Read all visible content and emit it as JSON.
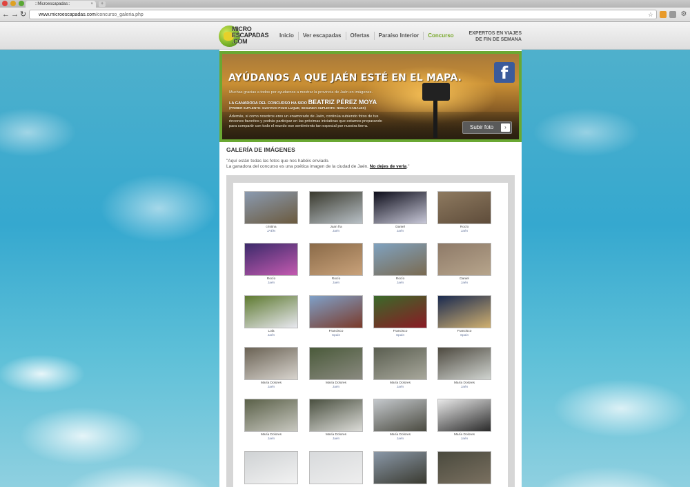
{
  "browser": {
    "tab_title": "::Microescapadas::",
    "tab_close": "×",
    "new_tab": "+",
    "url_host": "www.microescapadas.com",
    "url_path": "/concurso_galeria.php",
    "back": "←",
    "forward": "→",
    "reload": "↻"
  },
  "site": {
    "logo_line1": "MICRO",
    "logo_line2": "ESCAPADAS",
    "logo_line3": ".COM",
    "nav": [
      "Inicio",
      "Ver escapadas",
      "Ofertas",
      "Paraíso Interior",
      "Concurso"
    ],
    "tagline_line1": "EXPERTOS EN VIAJES",
    "tagline_line2": "DE FIN DE SEMANA"
  },
  "banner": {
    "title": "AYÚDANOS A QUE JAÉN ESTÉ EN EL MAPA.",
    "thanks": "Muchas gracias a todos por ayudarnos a mostrar la provincia de Jaén en imágenes.",
    "winner_prefix": "LA GANADORA DEL CONCURSO HA SIDO",
    "winner_name": "BEATRIZ PÉREZ MOYA",
    "substitutes": "(PRIMER SUPLENTE: GUSTAVO POZO LUQUE; SEGUNDA SUPLENTE: NOELIA CANALES)",
    "body1": "Además, si como nosotros eres un enamorado de Jaén, continúa subiendo fotos de tus",
    "body2": "rincones favoritos y podrás participar en las próximas iniciativas que estamos preparando",
    "body3": "para compartir con todo el mundo ese sentimiento tan especial por nuestra tierra.",
    "upload_button": "Subir foto",
    "facebook_letter": "f"
  },
  "gallery": {
    "title": "GALERÍA DE IMÁGENES",
    "intro1": "\"Aquí están todas las fotos que nos habéis enviado.",
    "intro2": "La ganadora del concurso es una poética imagen de la ciudad de Jaén.",
    "intro_link": "No dejes de verla",
    "intro_end": ".\"",
    "items": [
      {
        "name": "cristina",
        "place": "JAÉN",
        "colors": [
          "#8a9ab0",
          "#6b5a3e"
        ]
      },
      {
        "name": "Juan fra",
        "place": "Jaén",
        "colors": [
          "#3a3a2e",
          "#b8c0c6"
        ]
      },
      {
        "name": "Daniel",
        "place": "Jaén",
        "colors": [
          "#0d0d1a",
          "#c8c8d8"
        ]
      },
      {
        "name": "Rocío",
        "place": "Jaén",
        "colors": [
          "#8e7a60",
          "#5e4c3a"
        ]
      },
      {
        "name": "Rocío",
        "place": "Jaén",
        "colors": [
          "#3b2a6a",
          "#c45ab0"
        ]
      },
      {
        "name": "Rocío",
        "place": "Jaén",
        "colors": [
          "#8a6a48",
          "#c9a27a"
        ]
      },
      {
        "name": "Rocío",
        "place": "Jaén",
        "colors": [
          "#7fa2c0",
          "#7a6a50"
        ]
      },
      {
        "name": "Daniel",
        "place": "Jaén",
        "colors": [
          "#8e7a68",
          "#b7a58c"
        ]
      },
      {
        "name": "Lola",
        "place": "Jaén",
        "colors": [
          "#5e7a30",
          "#e8e8f0"
        ]
      },
      {
        "name": "Francisco",
        "place": "Spain",
        "colors": [
          "#7fa0c8",
          "#7a3a2a"
        ]
      },
      {
        "name": "Francisco",
        "place": "Spain",
        "colors": [
          "#3a6a2a",
          "#8a1a24"
        ]
      },
      {
        "name": "Francisco",
        "place": "Spain",
        "colors": [
          "#1a2a50",
          "#d0b070"
        ]
      },
      {
        "name": "María Dolores",
        "place": "Jaén",
        "colors": [
          "#6a6254",
          "#d8d4ce"
        ]
      },
      {
        "name": "María Dolores",
        "place": "Jaén",
        "colors": [
          "#4a5a3a",
          "#8a8a80"
        ]
      },
      {
        "name": "María Dolores",
        "place": "Jaén",
        "colors": [
          "#5a5e50",
          "#a8a89c"
        ]
      },
      {
        "name": "María Dolores",
        "place": "Jaén",
        "colors": [
          "#4e4a40",
          "#d0d4d0"
        ]
      },
      {
        "name": "María Dolores",
        "place": "Jaén",
        "colors": [
          "#5a6048",
          "#c8c8c0"
        ]
      },
      {
        "name": "María Dolores",
        "place": "Jaén",
        "colors": [
          "#4a5040",
          "#dcdcd8"
        ]
      },
      {
        "name": "María Dolores",
        "place": "Jaén",
        "colors": [
          "#c4c8cc",
          "#4a4a40"
        ]
      },
      {
        "name": "María Dolores",
        "place": "Jaén",
        "colors": [
          "#e8e8e8",
          "#2a2a2a"
        ]
      },
      {
        "name": "",
        "place": "",
        "colors": [
          "#cfd2d4",
          "#f2f2f2"
        ]
      },
      {
        "name": "",
        "place": "",
        "colors": [
          "#d8dadc",
          "#eeeeee"
        ]
      },
      {
        "name": "",
        "place": "",
        "colors": [
          "#8a98a8",
          "#3a3a30"
        ]
      },
      {
        "name": "",
        "place": "",
        "colors": [
          "#4a4a3e",
          "#7a7060"
        ]
      }
    ]
  }
}
